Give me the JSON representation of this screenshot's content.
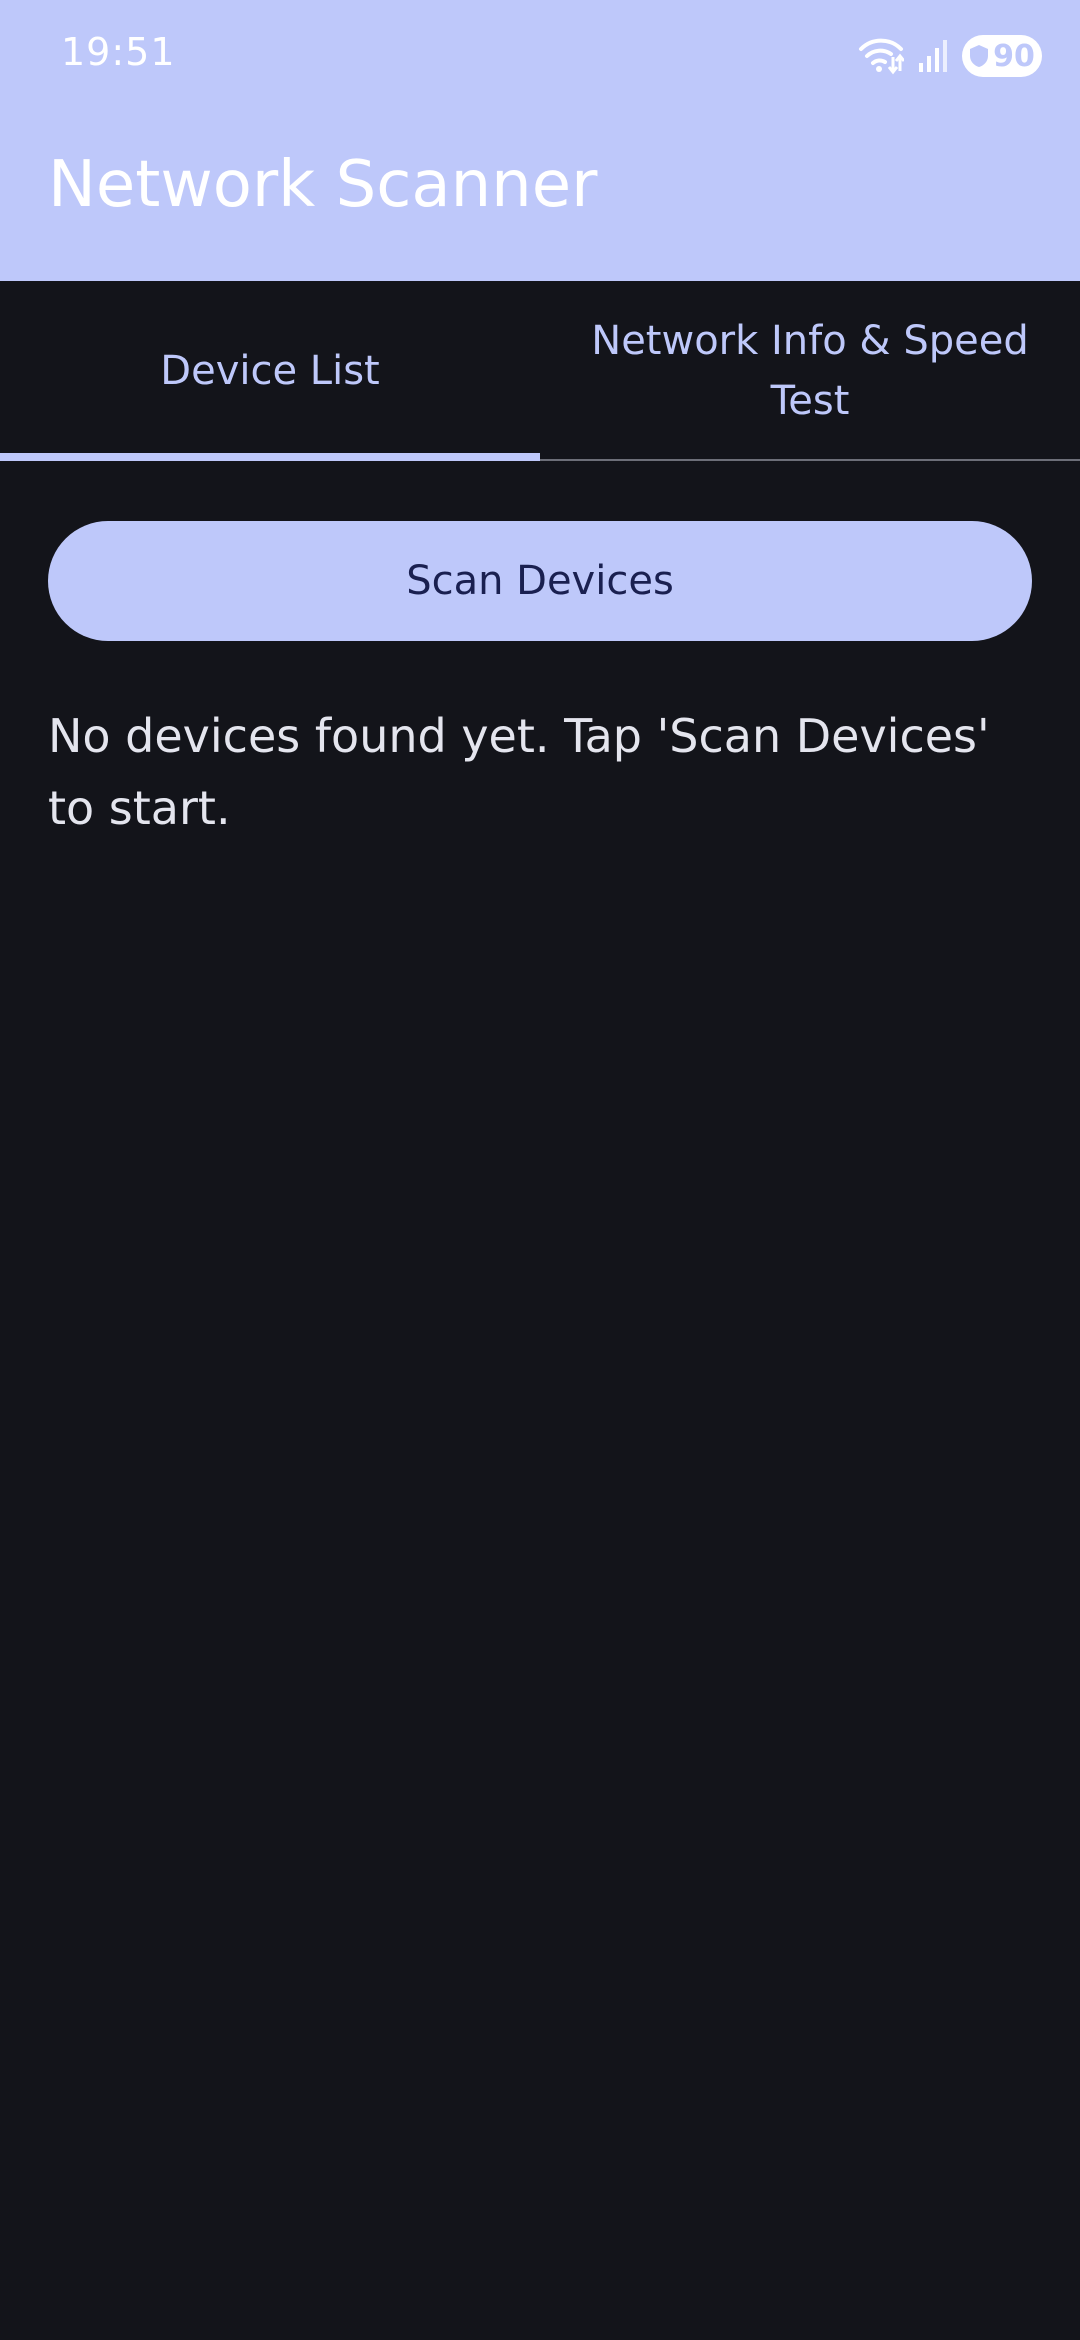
{
  "status_bar": {
    "time": "19:51",
    "battery_level": "90",
    "icons": [
      "wifi-icon",
      "signal-icon",
      "battery-icon"
    ]
  },
  "app_bar": {
    "title": "Network Scanner"
  },
  "tabs": [
    {
      "label": "Device List",
      "selected": true
    },
    {
      "label": "Network Info & Speed Test",
      "selected": false
    }
  ],
  "device_list": {
    "scan_button_label": "Scan Devices",
    "empty_message": "No devices found yet. Tap 'Scan Devices' to start."
  },
  "colors": {
    "primary": "#bec8fa",
    "background": "#13141a",
    "on_primary": "#1a2050",
    "text": "#e4e5ee"
  }
}
